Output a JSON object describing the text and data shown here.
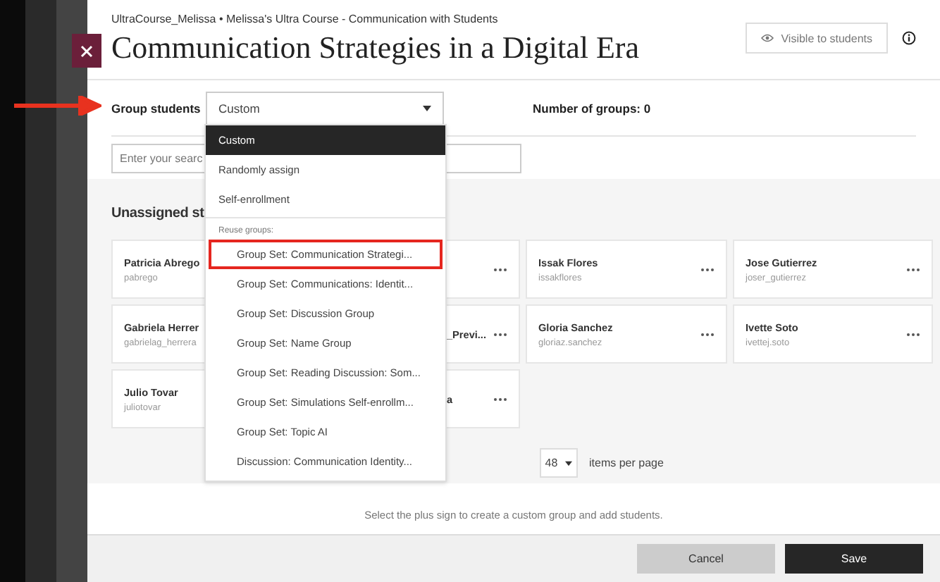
{
  "breadcrumb": "UltraCourse_Melissa • Melissa's Ultra Course - Communication with Students",
  "title": "Communication Strategies in a Digital Era",
  "visibility_button": {
    "label": "Visible to students"
  },
  "group_students": {
    "label": "Group students",
    "value": "Custom",
    "expanded": true
  },
  "number_of_groups": "Number of groups: 0",
  "search": {
    "placeholder": "Enter your searc"
  },
  "dropdown": {
    "options": [
      {
        "label": "Custom",
        "selected": true,
        "highlighted": false
      },
      {
        "label": "Randomly assign",
        "selected": false,
        "highlighted": false
      },
      {
        "label": "Self-enrollment",
        "selected": false,
        "highlighted": false
      }
    ],
    "section_label": "Reuse groups:",
    "group_options": [
      {
        "label": "Group Set: Communication Strategi...",
        "selected": false,
        "highlighted": true
      },
      {
        "label": "Group Set: Communications: Identit...",
        "selected": false,
        "highlighted": false
      },
      {
        "label": "Group Set: Discussion Group",
        "selected": false,
        "highlighted": false
      },
      {
        "label": "Group Set: Name Group",
        "selected": false,
        "highlighted": false
      },
      {
        "label": "Group Set: Reading Discussion: Som...",
        "selected": false,
        "highlighted": false
      },
      {
        "label": "Group Set: Simulations Self-enrollm...",
        "selected": false,
        "highlighted": false
      },
      {
        "label": "Group Set: Topic AI",
        "selected": false,
        "highlighted": false
      },
      {
        "label": "Discussion: Communication Identity...",
        "selected": false,
        "highlighted": false
      }
    ]
  },
  "unassigned_heading": "Unassigned st",
  "students": [
    {
      "kind": "full",
      "name": "Patricia Abrego",
      "username": "pabrego"
    },
    {
      "kind": "covered"
    },
    {
      "kind": "full",
      "name": "Issak Flores",
      "username": "issakflores"
    },
    {
      "kind": "full",
      "name": "Jose Gutierrez",
      "username": "joser_gutierrez"
    },
    {
      "kind": "full",
      "name": "Gabriela Herrer",
      "username": "gabrielag_herrera"
    },
    {
      "kind": "covered",
      "name": "_Previ..."
    },
    {
      "kind": "full",
      "name": "Gloria Sanchez",
      "username": "gloriaz.sanchez"
    },
    {
      "kind": "full",
      "name": "Ivette Soto",
      "username": "ivettej.soto"
    },
    {
      "kind": "full",
      "name": "Julio Tovar",
      "username": "juliotovar"
    },
    {
      "kind": "covered",
      "name": "a"
    }
  ],
  "pagination": {
    "per_page": "48",
    "label": "items per page"
  },
  "instruction": "Select the plus sign to create a custom group and add students.",
  "buttons": {
    "cancel": "Cancel",
    "save": "Save"
  }
}
